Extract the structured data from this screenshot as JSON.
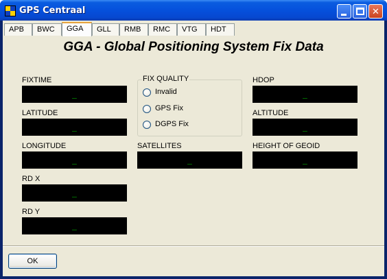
{
  "window": {
    "title": "GPS Centraal",
    "minimize_label": "",
    "maximize_label": "",
    "close_label": "✕"
  },
  "tabs": [
    {
      "label": "APB"
    },
    {
      "label": "BWC"
    },
    {
      "label": "GGA"
    },
    {
      "label": "GLL"
    },
    {
      "label": "RMB"
    },
    {
      "label": "RMC"
    },
    {
      "label": "VTG"
    },
    {
      "label": "HDT"
    }
  ],
  "active_tab": "GGA",
  "page": {
    "heading": "GGA - Global Positioning System Fix Data"
  },
  "fields": {
    "fixtime": {
      "label": "FIXTIME",
      "value": "_"
    },
    "latitude": {
      "label": "LATITUDE",
      "value": "_"
    },
    "longitude": {
      "label": "LONGITUDE",
      "value": "_"
    },
    "rdx": {
      "label": "RD X",
      "value": "_"
    },
    "rdy": {
      "label": "RD Y",
      "value": "_"
    },
    "satellites": {
      "label": "SATELLITES",
      "value": "_"
    },
    "hdop": {
      "label": "HDOP",
      "value": "_"
    },
    "altitude": {
      "label": "ALTITUDE",
      "value": "_"
    },
    "geoid": {
      "label": "HEIGHT OF GEOID",
      "value": "_"
    }
  },
  "fix_quality": {
    "title": "FIX QUALITY",
    "options": [
      {
        "label": "Invalid",
        "selected": false
      },
      {
        "label": "GPS Fix",
        "selected": false
      },
      {
        "label": "DGPS Fix",
        "selected": false
      }
    ]
  },
  "footer": {
    "ok_label": "OK"
  },
  "colors": {
    "titlebar": "#0550DC",
    "panel": "#ECE9D8",
    "readout_bg": "#000000",
    "readout_text": "#00E000"
  }
}
